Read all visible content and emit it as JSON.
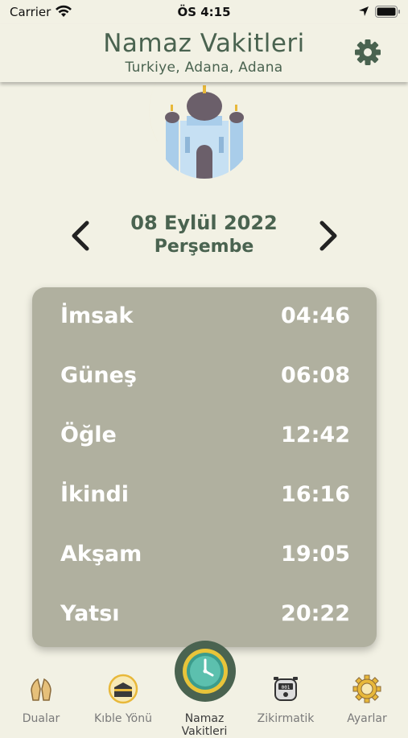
{
  "status": {
    "carrier": "Carrier",
    "time": "ÖS 4:15"
  },
  "header": {
    "title": "Namaz Vakitleri",
    "subtitle": "Turkiye, Adana, Adana"
  },
  "date": {
    "date": "08 Eylül 2022",
    "day": "Perşembe"
  },
  "times": [
    {
      "name": "İmsak",
      "time": "04:46"
    },
    {
      "name": "Güneş",
      "time": "06:08"
    },
    {
      "name": "Öğle",
      "time": "12:42"
    },
    {
      "name": "İkindi",
      "time": "16:16"
    },
    {
      "name": "Akşam",
      "time": "19:05"
    },
    {
      "name": "Yatsı",
      "time": "20:22"
    }
  ],
  "tabs": [
    {
      "label": "Dualar",
      "icon": "praying-hands-icon"
    },
    {
      "label": "Kıble Yönü",
      "icon": "kaaba-icon"
    },
    {
      "label": "Namaz Vakitleri",
      "icon": "clock-icon"
    },
    {
      "label": "Zikirmatik",
      "icon": "tally-counter-icon"
    },
    {
      "label": "Ayarlar",
      "icon": "settings-icon"
    }
  ],
  "colors": {
    "background": "#f2f1e4",
    "accent": "#4a6350",
    "card": "#b0b09f",
    "gold": "#e8b83a"
  }
}
